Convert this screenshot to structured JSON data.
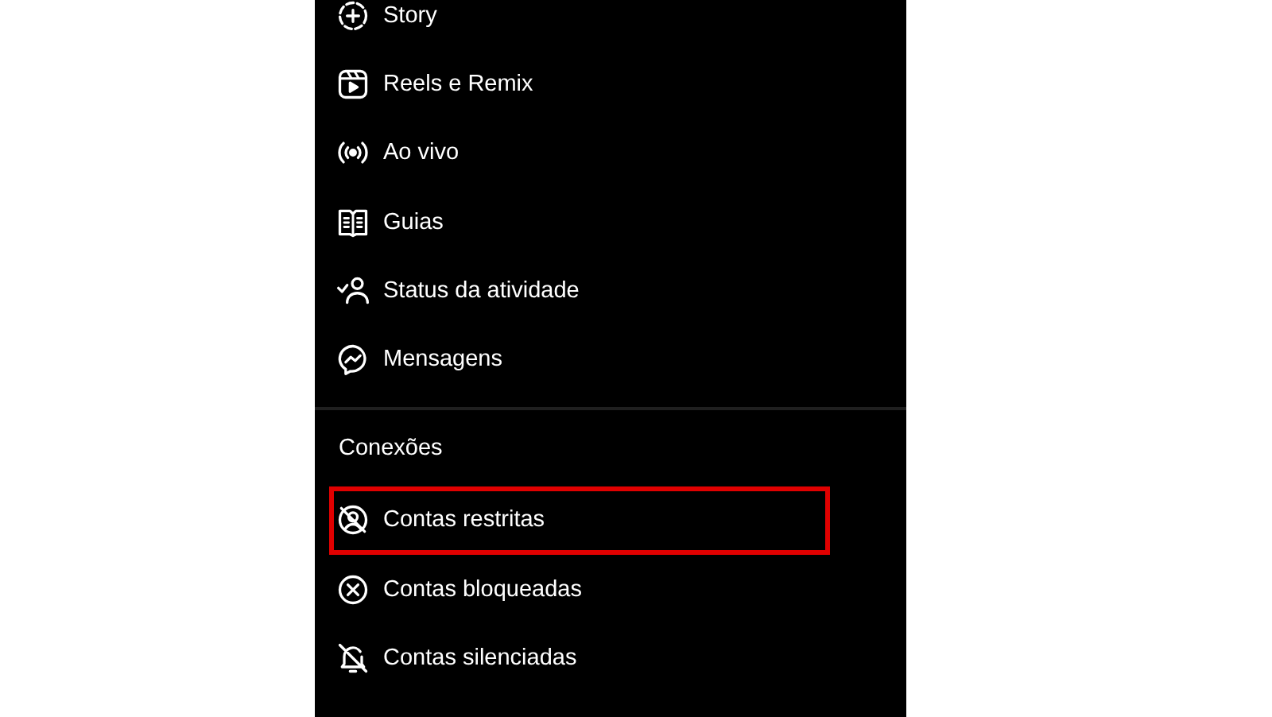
{
  "sections": [
    {
      "items": [
        {
          "label": "Story",
          "highlighted": false
        },
        {
          "label": "Reels e Remix",
          "highlighted": false
        },
        {
          "label": "Ao vivo",
          "highlighted": false
        },
        {
          "label": "Guias",
          "highlighted": false
        },
        {
          "label": "Status da atividade",
          "highlighted": false
        },
        {
          "label": "Mensagens",
          "highlighted": false
        }
      ]
    },
    {
      "title": "Conexões",
      "items": [
        {
          "label": "Contas restritas",
          "highlighted": true
        },
        {
          "label": "Contas bloqueadas",
          "highlighted": false
        },
        {
          "label": "Contas silenciadas",
          "highlighted": false
        }
      ]
    }
  ]
}
